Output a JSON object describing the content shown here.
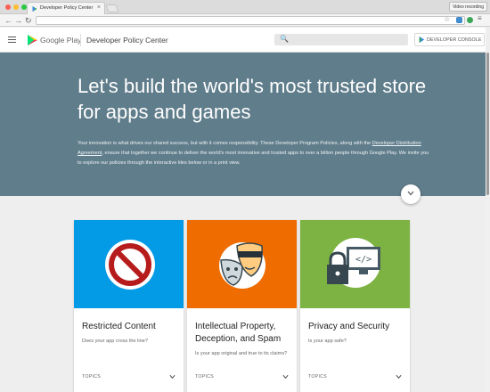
{
  "browser": {
    "tab_title": "Developer Policy Center",
    "tab_close": "×",
    "video_recording": "Video recording",
    "nav": {
      "back": "←",
      "forward": "→",
      "reload": "↻"
    },
    "star": "☆"
  },
  "header": {
    "brand": "Google Play",
    "title": "Developer Policy Center",
    "search_icon": "🔍",
    "console_button": "DEVELOPER CONSOLE"
  },
  "hero": {
    "title": "Let's build the world's most trusted store for apps and games",
    "body_pre": "Your innovation is what drives our shared success, but with it comes responsibility. These Developer Program Policies, along with the ",
    "body_link": "Developer Distribution Agreement",
    "body_post": ", ensure that together we continue to deliver the world's most innovative and trusted apps to over a billion people through Google Play. We invite you to explore our policies through the interactive tiles below or in a print view.",
    "colors": {
      "background": "#607d8b"
    }
  },
  "cards": [
    {
      "title": "Restricted Content",
      "subtitle": "Does your app cross the line?",
      "topics": "TOPICS",
      "icon": "prohibited-icon",
      "color": "#039be5"
    },
    {
      "title": "Intellectual Property, Deception, and Spam",
      "subtitle": "Is your app original and true to its claims?",
      "topics": "TOPICS",
      "icon": "masks-icon",
      "color": "#ef6c00"
    },
    {
      "title": "Privacy and Security",
      "subtitle": "Is your app safe?",
      "topics": "TOPICS",
      "icon": "lock-monitor-icon",
      "color": "#7cb342"
    }
  ]
}
